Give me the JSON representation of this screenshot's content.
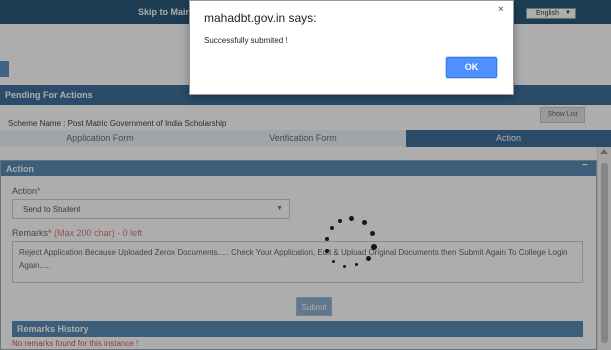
{
  "header": {
    "skip_link": "Skip to Main",
    "language": "English"
  },
  "section": {
    "title": "Pending For Actions",
    "show_list": "Show List",
    "scheme_name": "Scheme Name : Post Matric Government of India Scholarship"
  },
  "tabs": [
    {
      "label": "Application Form",
      "active": false
    },
    {
      "label": "Verification Form",
      "active": false
    },
    {
      "label": "Action",
      "active": true
    }
  ],
  "action_panel": {
    "title": "Action",
    "collapse_symbol": "−",
    "action_label": "Action",
    "required_mark": "*",
    "action_value": "Send to Student",
    "remarks_label": "Remarks",
    "remarks_limit": "(Max 200 char) - 0 left",
    "remarks_value": "Reject Application Because Uploaded Zerox Documents..... Check Your Application, Edit & Upload Original Documents then Submit Again To College Login Again.....",
    "submit_label": "Submit"
  },
  "remarks_history": {
    "title": "Remarks History",
    "empty_text": "No remarks found for this instance !"
  },
  "dialog": {
    "title": "mahadbt.gov.in says:",
    "message": "Successfully submited !",
    "ok_label": "OK",
    "close_symbol": "×"
  },
  "colors": {
    "header_blue": "#2c5a7c",
    "section_blue": "#3e709b",
    "panel_blue": "#5b8bb4",
    "ok_button": "#4d90fe",
    "required_red": "#e05050"
  }
}
